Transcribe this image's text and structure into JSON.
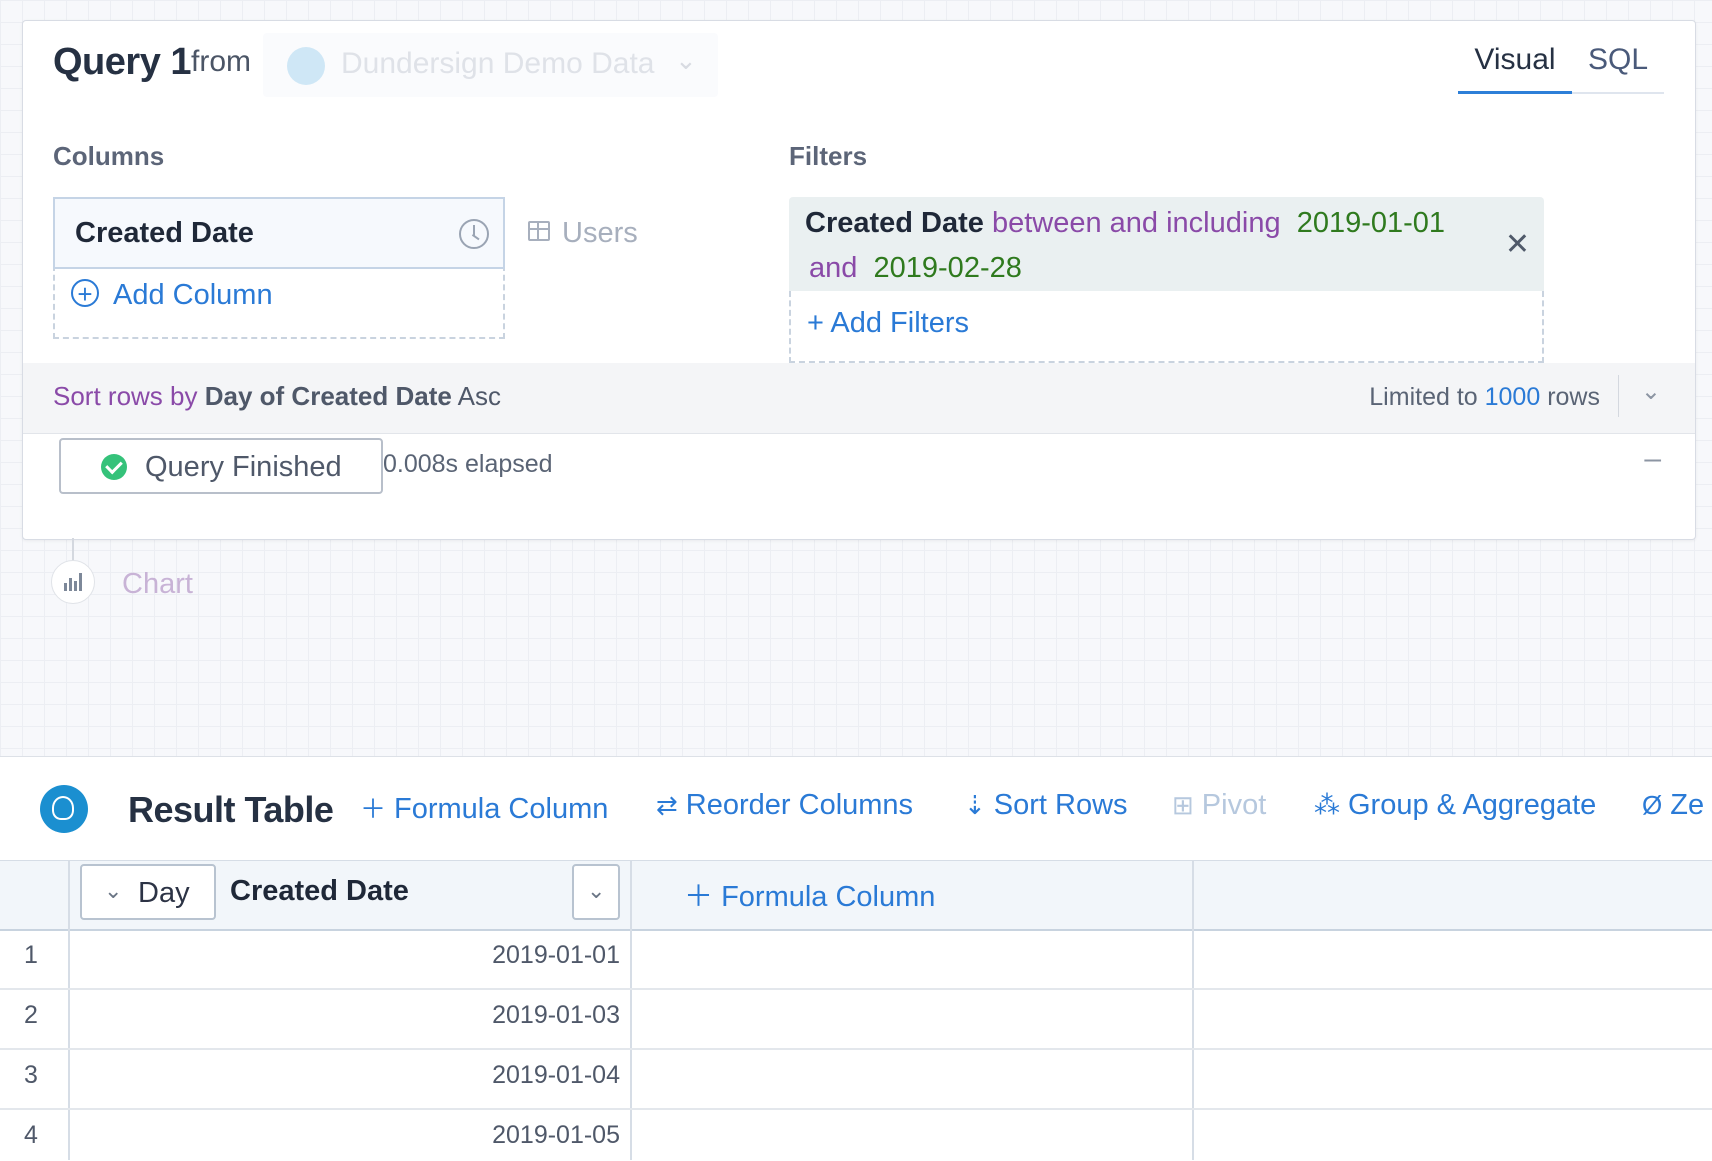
{
  "query": {
    "title": "Query 1",
    "from_label": "from",
    "datasource": "Dundersign Demo Data",
    "tabs": [
      {
        "label": "Visual",
        "active": true
      },
      {
        "label": "SQL",
        "active": false
      }
    ],
    "columns_label": "Columns",
    "columns": [
      {
        "label": "Created Date",
        "icon": "clock-icon"
      }
    ],
    "add_column_label": "Add Column",
    "table_name": "Users",
    "filters_label": "Filters",
    "filter": {
      "field": "Created Date",
      "operator": "between and including",
      "value_start": "2019-01-01",
      "conjunction": "and",
      "value_end": "2019-02-28"
    },
    "add_filters_label": "+ Add Filters",
    "sort": {
      "prefix": "Sort rows by",
      "target": "Day of Created Date",
      "direction": "Asc"
    },
    "limit": {
      "prefix": "Limited to",
      "value": "1000",
      "suffix": "rows"
    },
    "status": {
      "label": "Query Finished",
      "elapsed": "0.008s elapsed"
    },
    "collapse_symbol": "–"
  },
  "chart": {
    "label": "Chart"
  },
  "result": {
    "title": "Result Table",
    "toolbar": [
      {
        "label": "Formula Column",
        "icon": "plus-icon"
      },
      {
        "label": "Reorder Columns",
        "icon": "reorder-icon"
      },
      {
        "label": "Sort Rows",
        "icon": "sort-icon"
      },
      {
        "label": "Pivot",
        "icon": "pivot-icon",
        "disabled": true
      },
      {
        "label": "Group & Aggregate",
        "icon": "group-icon"
      },
      {
        "label": "Ze",
        "icon": "zero-icon"
      }
    ],
    "column": {
      "granularity": "Day",
      "label": "Created Date"
    },
    "formula_column_label": "Formula Column",
    "rows": [
      {
        "num": "1",
        "value": "2019-01-01"
      },
      {
        "num": "2",
        "value": "2019-01-03"
      },
      {
        "num": "3",
        "value": "2019-01-04"
      },
      {
        "num": "4",
        "value": "2019-01-05"
      }
    ]
  },
  "colors": {
    "accent": "#2a7ad6",
    "operator": "#8a4aa8",
    "value": "#2f7a1e",
    "success": "#35c27a"
  }
}
